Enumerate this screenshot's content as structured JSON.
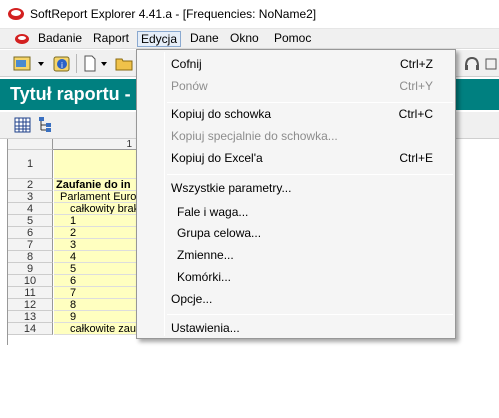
{
  "window": {
    "title": "SoftReport Explorer 4.41.a - [Frequencies: NoName2]"
  },
  "menu": {
    "items": [
      "Badanie",
      "Raport",
      "Edycja",
      "Dane",
      "Okno",
      "Pomoc"
    ],
    "active": "Edycja"
  },
  "report": {
    "header_title": "Tytuł raportu - kli"
  },
  "grid": {
    "column_header": "1",
    "rows": [
      {
        "num": "1",
        "text": ""
      },
      {
        "num": "2",
        "text": "Zaufanie do in"
      },
      {
        "num": "3",
        "text": "Parlament Euro"
      },
      {
        "num": "4",
        "text": "całkowity brak"
      },
      {
        "num": "5",
        "text": "1"
      },
      {
        "num": "6",
        "text": "2"
      },
      {
        "num": "7",
        "text": "3"
      },
      {
        "num": "8",
        "text": "4"
      },
      {
        "num": "9",
        "text": "5"
      },
      {
        "num": "10",
        "text": "6"
      },
      {
        "num": "11",
        "text": "7"
      },
      {
        "num": "12",
        "text": "8"
      },
      {
        "num": "13",
        "text": "9"
      },
      {
        "num": "14",
        "text": "całkowite zaufanie"
      }
    ]
  },
  "edit_menu": {
    "undo": {
      "label": "Cofnij",
      "shortcut": "Ctrl+Z"
    },
    "redo": {
      "label": "Ponów",
      "shortcut": "Ctrl+Y"
    },
    "copy": {
      "label": "Kopiuj do schowka",
      "shortcut": "Ctrl+C"
    },
    "paste_special": {
      "label": "Kopiuj specjalnie do schowka..."
    },
    "copy_excel": {
      "label": "Kopiuj do Excel'a",
      "shortcut": "Ctrl+E"
    },
    "all_params": {
      "label": "Wszystkie parametry..."
    },
    "filter_weight": {
      "label": "Fale i waga..."
    },
    "target_group": {
      "label": "Grupa celowa..."
    },
    "variables": {
      "label": "Zmienne..."
    },
    "cells": {
      "label": "Komórki..."
    },
    "options": {
      "label": "Opcje..."
    },
    "settings": {
      "label": "Ustawienia..."
    }
  },
  "colors": {
    "header_bg": "#008080",
    "cell_highlight": "#ffffc0",
    "menu_active_border": "#8aa9d0"
  },
  "icons": [
    "app-logo-icon",
    "window-menu-icon",
    "open-report-icon",
    "info-icon",
    "new-document-icon",
    "open-folder-icon",
    "headphones-icon",
    "grid-icon",
    "tree-icon"
  ]
}
